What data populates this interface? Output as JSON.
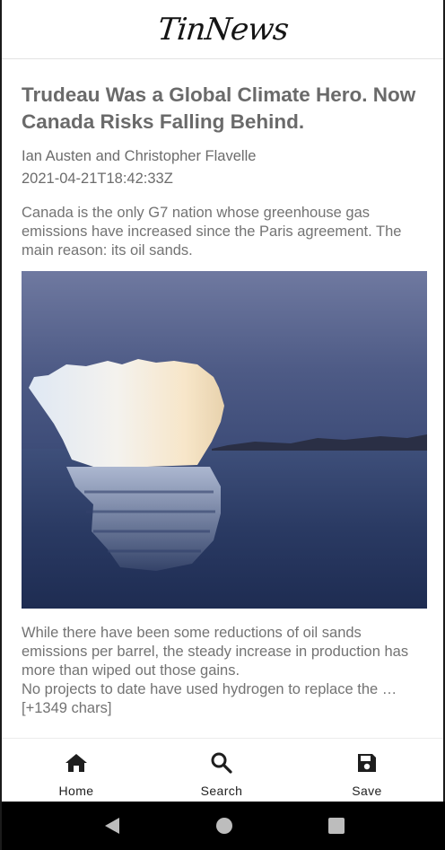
{
  "app": {
    "brand": "TinNews"
  },
  "article": {
    "title": "Trudeau Was a Global Climate Hero. Now Canada Risks Falling Behind.",
    "author": "Ian Austen and Christopher Flavelle",
    "published_at": "2021-04-21T18:42:33Z",
    "description": "Canada is the only G7 nation whose greenhouse gas emissions have increased since the Paris agreement. The main reason: its oil sands.",
    "content_line_1": "While there have been some reductions of oil sands emissions per barrel, the steady increase in production has more than wiped out those gains.",
    "content_line_2": "No projects to date have used hydrogen to replace the … [+1349 chars]"
  },
  "bottom_nav": {
    "items": [
      {
        "label": "Home",
        "icon": "home-icon"
      },
      {
        "label": "Search",
        "icon": "search-icon"
      },
      {
        "label": "Save",
        "icon": "save-icon"
      }
    ]
  },
  "system_nav": {
    "buttons": [
      "back-icon",
      "home-circle-icon",
      "recents-icon"
    ]
  },
  "colors": {
    "text_gray": "#6a6a6a",
    "nav_text": "#1e1e1e",
    "sysbar": "#000000"
  }
}
